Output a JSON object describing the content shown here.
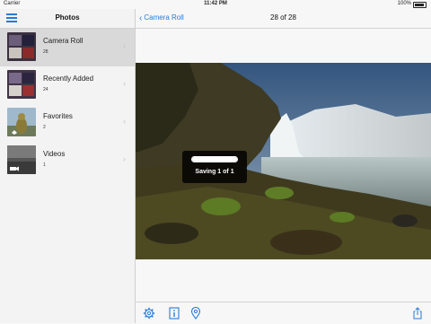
{
  "status_bar": {
    "carrier": "Carrier",
    "time": "11:42 PM",
    "battery": "100%"
  },
  "sidebar": {
    "title": "Photos",
    "albums": [
      {
        "name": "Camera Roll",
        "count": "28",
        "selected": true
      },
      {
        "name": "Recently Added",
        "count": "24"
      },
      {
        "name": "Favorites",
        "count": "2"
      },
      {
        "name": "Videos",
        "count": "1"
      }
    ]
  },
  "main": {
    "back_label": "Camera Roll",
    "counter": "28 of 28"
  },
  "hud": {
    "text": "Saving 1 of 1",
    "progress": 1.0
  },
  "toolbar": {
    "icons": [
      "gear-icon",
      "info-icon",
      "location-pin-icon",
      "share-icon"
    ]
  },
  "colors": {
    "accent": "#2a7ad8",
    "sidebar_bg": "#f3f3f3",
    "selected_bg": "#d9d9d9"
  }
}
